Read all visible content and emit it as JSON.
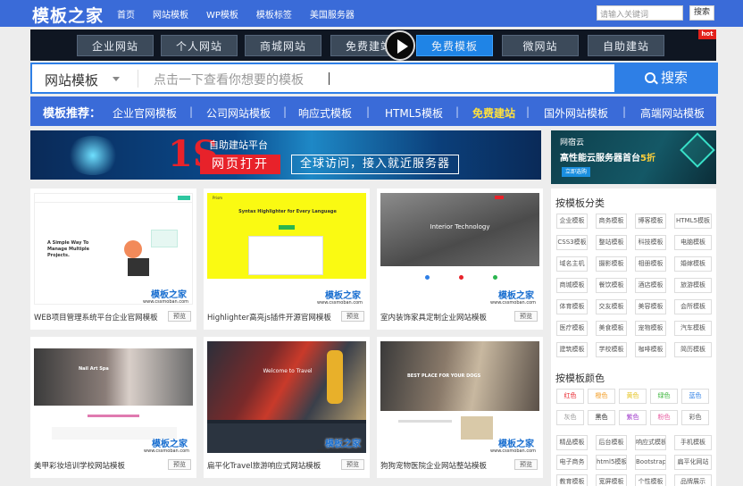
{
  "header": {
    "logo": "模板之家",
    "nav": [
      "首页",
      "网站模板",
      "WP模板",
      "模板标签",
      "美国服务器"
    ],
    "search_placeholder": "请输入关键词",
    "search_button": "搜索"
  },
  "categories": {
    "items": [
      "企业网站",
      "个人网站",
      "商城网站",
      "免费建站",
      "免费模板",
      "微网站",
      "自助建站"
    ],
    "active_index": 4,
    "hot_badge": "hot"
  },
  "search": {
    "select_value": "网站模板",
    "placeholder": "点击一下查看你想要的模板",
    "button": "搜索"
  },
  "recommend": {
    "title": "模板推荐：",
    "links": [
      "企业官网模板",
      "公司网站模板",
      "响应式模板",
      "HTML5模板",
      "免费建站",
      "国外网站模板",
      "高端网站模板"
    ],
    "highlight_index": 4
  },
  "banner_main": {
    "big": "1S",
    "sub": "自助建站平台",
    "box1": "网页打开",
    "box2": "全球访问，接入就近服务器"
  },
  "banner_side": {
    "logo": "网宿云",
    "text_prefix": "高性能云服务器首台",
    "text_highlight": "5折",
    "button": "立即选购"
  },
  "templates": [
    {
      "caption": "WEB项目管理系统平台企业官网模板",
      "preview": "预览",
      "thumb_title": "A Simple Way To Manage Multiple Projects."
    },
    {
      "caption": "Highlighter高亮js插件开源官网模板",
      "preview": "预览",
      "thumb_title": "Syntax Highlighter for Every Language"
    },
    {
      "caption": "室内装饰家具定制企业网站模板",
      "preview": "预览",
      "thumb_title": "Interior Technology"
    },
    {
      "caption": "美甲彩妆培训学校网站模板",
      "preview": "预览",
      "thumb_title": "Nail Art Spa"
    },
    {
      "caption": "扁平化Travel旅游响应式网站模板",
      "preview": "预览",
      "thumb_title": "Welcome to Travel"
    },
    {
      "caption": "狗狗宠物医院企业网站整站模板",
      "preview": "预览",
      "thumb_title": "BEST PLACE FOR YOUR DOGS"
    }
  ],
  "watermark": {
    "text": "模板之家",
    "url": "www.cssmoban.com"
  },
  "sidebar": {
    "category_title": "按模板分类",
    "categories": [
      "企业模板",
      "商务模板",
      "博客模板",
      "HTML5模板",
      "CSS3模板",
      "整站模板",
      "科技模板",
      "电脑模板",
      "域名主机",
      "摄影模板",
      "相册模板",
      "婚嫁模板",
      "商城模板",
      "餐饮模板",
      "酒店模板",
      "旅游模板",
      "体育模板",
      "交友模板",
      "美容模板",
      "会所模板",
      "医疗模板",
      "美食模板",
      "宠物模板",
      "汽车模板",
      "建筑模板",
      "学校模板",
      "咖啡模板",
      "简历模板"
    ],
    "color_title": "按模板颜色",
    "colors": [
      {
        "label": "红色",
        "color": "#e8222a"
      },
      {
        "label": "橙色",
        "color": "#f39a1e"
      },
      {
        "label": "黄色",
        "color": "#e4c21c"
      },
      {
        "label": "绿色",
        "color": "#3ab53a"
      },
      {
        "label": "蓝色",
        "color": "#2e7fe6"
      },
      {
        "label": "灰色",
        "color": "#999999"
      },
      {
        "label": "黑色",
        "color": "#222222"
      },
      {
        "label": "紫色",
        "color": "#9b30c8"
      },
      {
        "label": "粉色",
        "color": "#e85aa0"
      },
      {
        "label": "彩色",
        "color": "#555555"
      }
    ],
    "styles": [
      "精品模板",
      "后台模板",
      "响应式模板",
      "手机模板",
      "电子商务",
      "html5模板",
      "Bootstrap",
      "扁平化网站",
      "教育模板",
      "宽屏模板",
      "个性模板",
      "品牌展示"
    ]
  }
}
